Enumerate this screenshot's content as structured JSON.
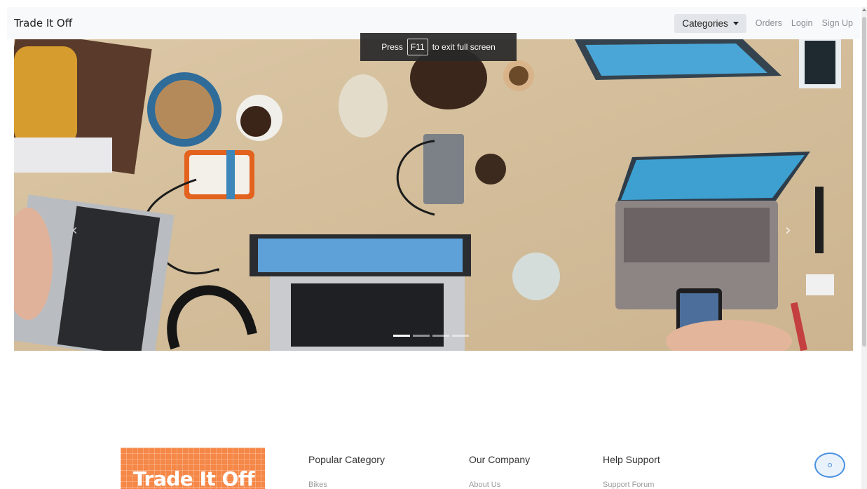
{
  "navbar": {
    "brand": "Trade It Off",
    "categories_label": "Categories",
    "links": {
      "orders": "Orders",
      "login": "Login",
      "signup": "Sign Up"
    }
  },
  "fullscreen_toast": {
    "prefix": "Press",
    "key": "F11",
    "suffix": "to exit full screen"
  },
  "carousel": {
    "prev_icon": "‹",
    "next_icon": "›",
    "slide_count": 4,
    "active_slide": 1
  },
  "footer": {
    "logo_text": "Trade It Off",
    "columns": [
      {
        "heading": "Popular Category",
        "first_link": "Bikes"
      },
      {
        "heading": "Our Company",
        "first_link": "About Us"
      },
      {
        "heading": "Help Support",
        "first_link": "Support Forum"
      }
    ]
  },
  "colors": {
    "logo_bg": "#f58747",
    "navbar_bg": "#f8f9fa",
    "fab_border": "#4a90e2"
  }
}
